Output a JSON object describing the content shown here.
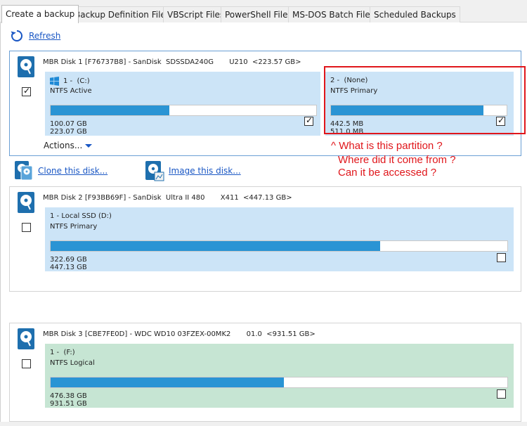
{
  "tabs": [
    {
      "label": "Create a backup",
      "active": true
    },
    {
      "label": "Backup Definition Files",
      "active": false
    },
    {
      "label": "VBScript Files",
      "active": false
    },
    {
      "label": "PowerShell Files",
      "active": false
    },
    {
      "label": "MS-DOS Batch Files",
      "active": false
    },
    {
      "label": "Scheduled Backups",
      "active": false
    }
  ],
  "toolbar": {
    "refresh_label": "Refresh"
  },
  "disks": [
    {
      "title": "MBR Disk 1 [F76737B8] - SanDisk  SDSSDA240G       U210  <223.57 GB>",
      "checked": true,
      "actions_label": "Actions...",
      "partitions": [
        {
          "label": "1 -  (C:)",
          "type": "NTFS Active",
          "used": "100.07 GB",
          "total": "223.07 GB",
          "fill_fraction": 0.448,
          "checked": true
        },
        {
          "label": "2 -  (None)",
          "type": "NTFS Primary",
          "used": "442.5 MB",
          "total": "511.0 MB",
          "fill_fraction": 0.866,
          "checked": true
        }
      ]
    },
    {
      "title": "MBR Disk 2 [F93BB69F] - SanDisk  Ultra II 480       X411  <447.13 GB>",
      "checked": false,
      "partitions": [
        {
          "label": "1 - Local SSD (D:)",
          "type": "NTFS Primary",
          "used": "322.69 GB",
          "total": "447.13 GB",
          "fill_fraction": 0.722,
          "checked": false
        }
      ]
    },
    {
      "title": "MBR Disk 3 [CBE7FE0D] - WDC WD10 03FZEX-00MK2       01.0  <931.51 GB>",
      "checked": false,
      "partitions": [
        {
          "label": "1 -  (F:)",
          "type": "NTFS Logical",
          "used": "476.38 GB",
          "total": "931.51 GB",
          "fill_fraction": 0.511,
          "checked": false
        }
      ]
    }
  ],
  "tools": {
    "clone_label": "Clone this disk...",
    "image_label": "Image this disk..."
  },
  "annotation": {
    "line1": "^ What is this partition ?",
    "line2": "Where did it come from ?",
    "line3": "Can it be accessed ?",
    "color": "#e0161b"
  },
  "colors": {
    "bar_fill": "#2a94d4",
    "partition_bg": "#cce4f7",
    "logical_bg": "#c6e5d3",
    "link": "#1a57c4"
  }
}
